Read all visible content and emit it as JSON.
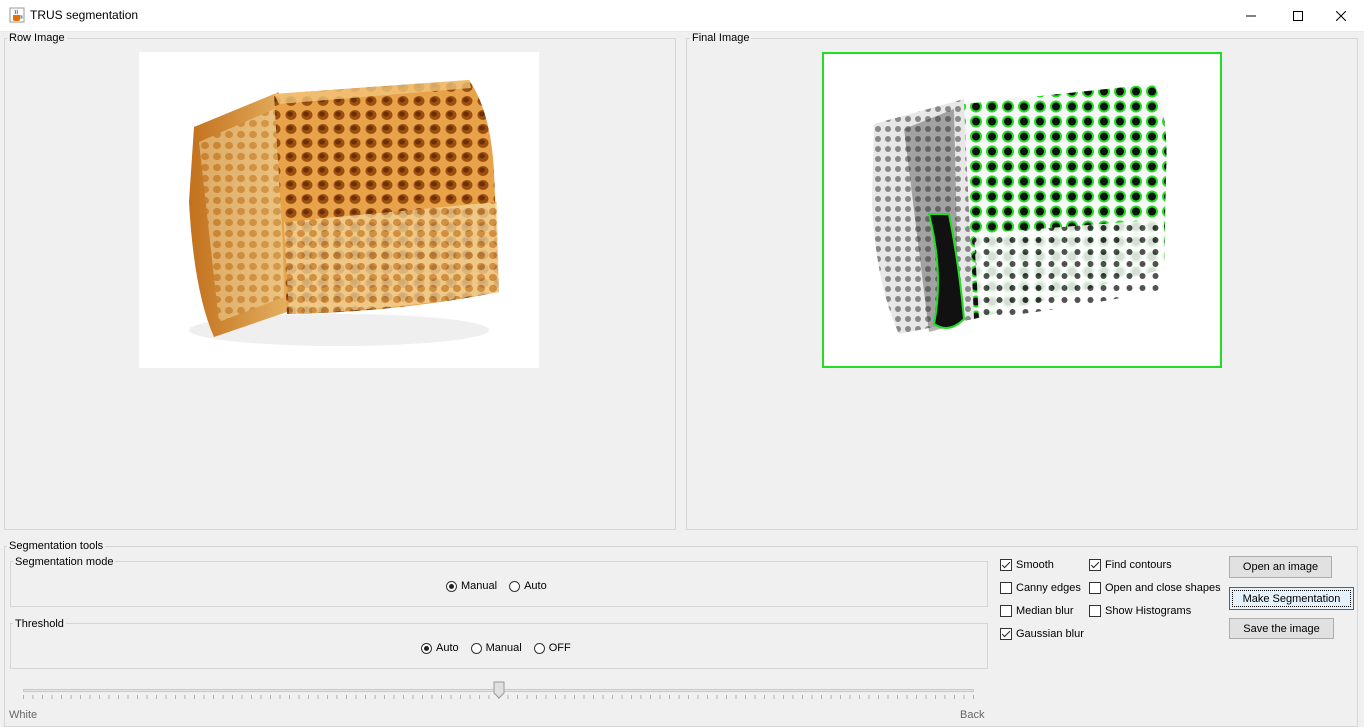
{
  "window": {
    "title": "TRUS segmentation",
    "icon": "java-cup-icon",
    "controls": [
      "minimize-icon",
      "maximize-icon",
      "close-icon"
    ]
  },
  "panels": {
    "left_title": "Row Image",
    "right_title": "Final Image"
  },
  "tools": {
    "title": "Segmentation tools",
    "mode": {
      "title": "Segmentation mode",
      "options": [
        {
          "label": "Manual",
          "selected": true
        },
        {
          "label": "Auto",
          "selected": false
        }
      ]
    },
    "threshold": {
      "title": "Threshold",
      "options": [
        {
          "label": "Auto",
          "selected": true
        },
        {
          "label": "Manual",
          "selected": false
        },
        {
          "label": "OFF",
          "selected": false
        }
      ]
    },
    "slider": {
      "min_label": "White",
      "max_label": "Back",
      "value_fraction": 0.5
    }
  },
  "checks": [
    {
      "label": "Smooth",
      "checked": true
    },
    {
      "label": "Find contours",
      "checked": true
    },
    {
      "label": "Canny edges",
      "checked": false
    },
    {
      "label": "Open and close shapes",
      "checked": false
    },
    {
      "label": "Median blur",
      "checked": false
    },
    {
      "label": "Show Histograms",
      "checked": false
    },
    {
      "label": "Gaussian blur",
      "checked": true
    }
  ],
  "buttons": {
    "open": "Open an image",
    "segment": "Make Segmentation",
    "save": "Save the image"
  },
  "colors": {
    "contour": "#22dd22",
    "honey": "#d98a2b"
  }
}
